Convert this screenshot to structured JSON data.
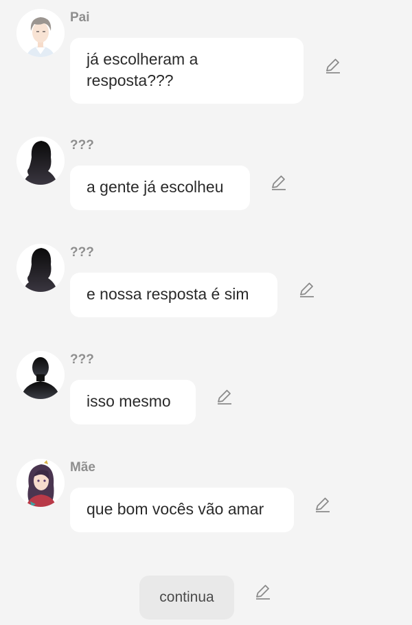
{
  "messages": [
    {
      "sender": "Pai",
      "text": "já escolheram a resposta???",
      "avatar": "father-avatar"
    },
    {
      "sender": "???",
      "text": "a gente já escolheu",
      "avatar": "unknown-silhouette-avatar"
    },
    {
      "sender": "???",
      "text": "e nossa resposta é sim",
      "avatar": "unknown-silhouette-avatar"
    },
    {
      "sender": "???",
      "text": "isso mesmo",
      "avatar": "unknown-male-silhouette-avatar"
    },
    {
      "sender": "Mãe",
      "text": "que bom vocês vão amar",
      "avatar": "mother-avatar"
    }
  ],
  "continue_button": {
    "label": "continua"
  },
  "icons": {
    "edit": "pencil-icon"
  },
  "colors": {
    "background": "#f4f4f4",
    "bubble": "#ffffff",
    "sender_name": "#8e8e8e",
    "message_text": "#2a2a2a",
    "icon": "#8a8a8a",
    "continue_button_bg": "#e9e9e9"
  }
}
